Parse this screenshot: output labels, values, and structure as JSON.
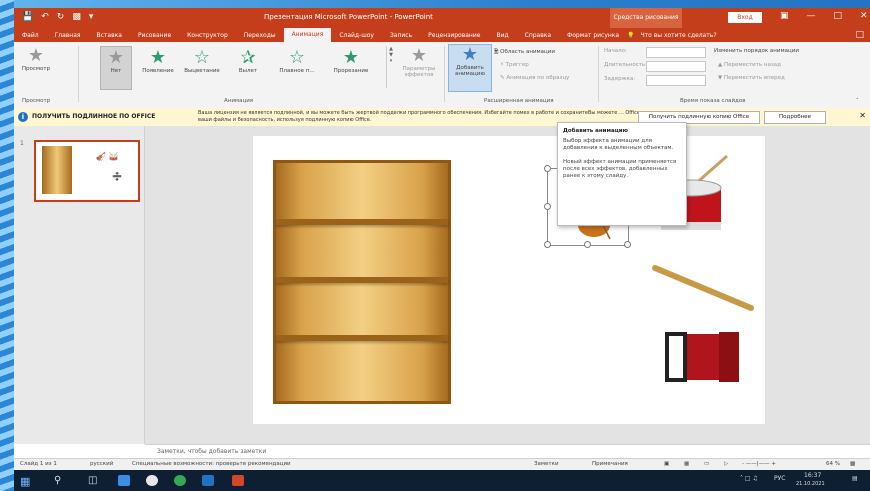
{
  "titlebar": {
    "title": "Презентация Microsoft PowerPoint - PowerPoint",
    "drawing_tools": "Средства рисования",
    "login": "Вход",
    "qat_icons": [
      "save-icon",
      "undo-icon",
      "redo-icon",
      "start-slideshow-icon"
    ]
  },
  "tabs": [
    "Файл",
    "Главная",
    "Вставка",
    "Рисование",
    "Конструктор",
    "Переходы",
    "Анимация",
    "Слайд-шоу",
    "Запись",
    "Рецензирование",
    "Вид",
    "Справка",
    "Формат рисунка"
  ],
  "active_tab": "Анимация",
  "tellme": "Что вы хотите сделать?",
  "ribbon": {
    "preview": "Просмотр",
    "preview_group": "Просмотр",
    "animations": [
      "Нет",
      "Появление",
      "Выцветание",
      "Вылет",
      "Плавное п...",
      "Прорезание"
    ],
    "effect_params": "Параметры эффектов",
    "anim_group": "Анимация",
    "add_animation": "Добавить анимацию",
    "anim_pane": "Область анимации",
    "trigger": "Триггер",
    "painter": "Анимация по образцу",
    "adv_group": "Расширенная анимация",
    "start": "Начало:",
    "duration": "Длительность:",
    "delay": "Задержка:",
    "reorder": "Изменить порядок анимации",
    "move_earlier": "Переместить назад",
    "move_later": "Переместить вперед",
    "timing_group": "Время показа слайдов"
  },
  "infobar": {
    "title": "ПОЛУЧИТЬ ПОДЛИННОЕ ПО OFFICE",
    "message": "Ваша лицензия не является подлинной, и вы можете быть жертвой подделки программного обеспечения. Избегайте помех в работе и сохраните ваши файлы и безопасность, используя подлинную копию Office.",
    "message_tail": "Вы можете ... Office.",
    "btn_get": "Получить подлинную копию Office",
    "btn_more": "Подробнее"
  },
  "tooltip": {
    "title": "Добавить анимацию",
    "line1": "Выбор эффекта анимации для добавления к выделенным объектам.",
    "line2": "Новый эффект анимации применяется после всех эффектов, добавленных ранее к этому слайду."
  },
  "slide_number": "1",
  "notes": "Заметки, чтобы добавить заметки",
  "status": {
    "slide": "Слайд 1 из 1",
    "lang": "русский",
    "accessibility": "Специальные возможности: проверьте рекомендации",
    "notes_btn": "Заметки",
    "comments_btn": "Примечания",
    "zoom": "64 %"
  },
  "tray": {
    "lang": "РУС",
    "time": "16:37",
    "date": "21.10.2021"
  },
  "colors": {
    "accent": "#c43e1c",
    "info": "#fff6d2"
  }
}
